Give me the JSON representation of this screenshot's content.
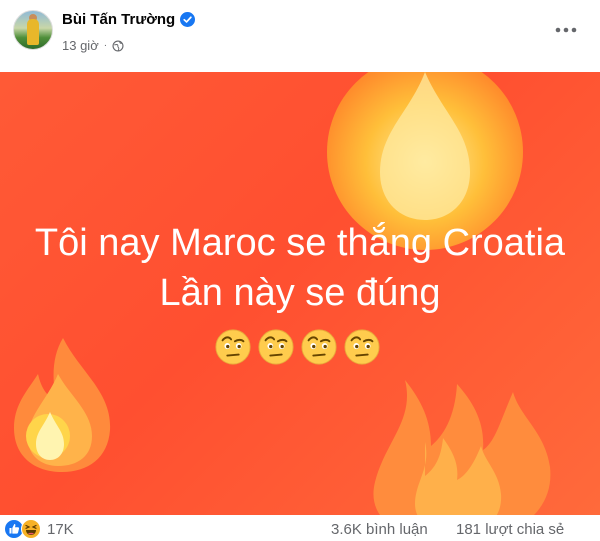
{
  "post": {
    "author": "Bùi Tấn Trường",
    "time": "13 giờ",
    "separator": "·",
    "privacy_icon": "globe-icon",
    "verified_icon": "verified-badge-icon",
    "more_icon": "more-options-icon"
  },
  "banner": {
    "line1": "Tôi nay Maroc se thắng Croatia",
    "line2": "Lần này se đúng",
    "emojis": [
      "face-with-raised-eyebrow",
      "face-with-raised-eyebrow",
      "face-with-raised-eyebrow",
      "face-with-raised-eyebrow"
    ],
    "background_color": "#ff5233",
    "decoration_icons": [
      "fire-icon",
      "fire-icon",
      "fire-icon"
    ]
  },
  "stats": {
    "reaction_icons": [
      "like-icon",
      "haha-icon"
    ],
    "reaction_count": "17K",
    "comments": "3.6K bình luận",
    "shares": "181 lượt chia sẻ"
  },
  "colors": {
    "verified": "#1877f2",
    "muted_text": "#65676b",
    "like_blue": "#1877f2",
    "haha_yellow": "#f7b125"
  }
}
